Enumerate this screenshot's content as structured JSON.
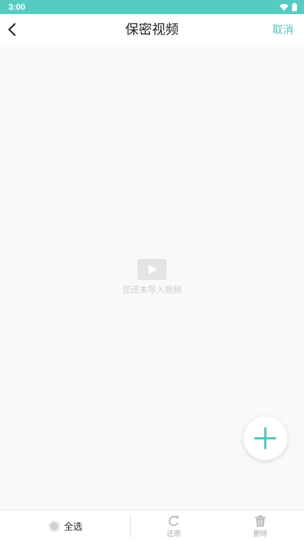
{
  "status_bar": {
    "time": "3:00",
    "icons": [
      "wifi-icon",
      "battery-icon"
    ],
    "background_color": "#56cbc2"
  },
  "header": {
    "title": "保密视频",
    "cancel_label": "取消",
    "back_icon": "back-arrow-icon",
    "accent_color": "#4fc3bd"
  },
  "empty_state": {
    "icon": "video-play-icon",
    "message": "您还未导入视频"
  },
  "fab": {
    "icon": "plus-icon"
  },
  "bottom_bar": {
    "select_all_label": "全选",
    "restore_label": "还原",
    "delete_label": "删除",
    "restore_icon": "refresh-icon",
    "delete_icon": "trash-icon"
  }
}
